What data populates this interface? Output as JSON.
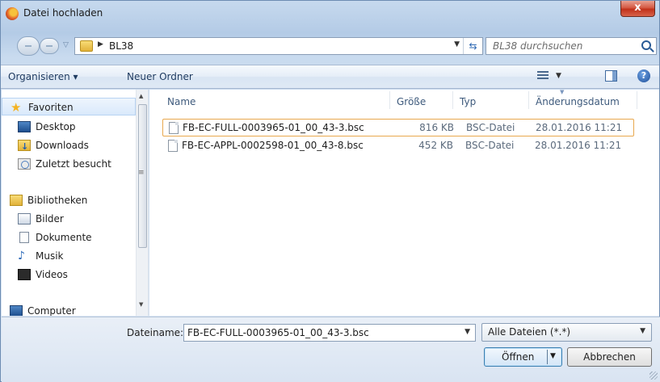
{
  "window": {
    "title": "Datei hochladen",
    "close_label": "x"
  },
  "nav": {
    "breadcrumb": "BL38",
    "search_placeholder": "BL38 durchsuchen"
  },
  "toolbar": {
    "organize": "Organisieren ▾",
    "new_folder": "Neuer Ordner"
  },
  "sidebar": {
    "items": [
      {
        "label": "Favoriten",
        "icon": "star-icon"
      },
      {
        "label": "Desktop",
        "icon": "desktop-icon"
      },
      {
        "label": "Downloads",
        "icon": "downloads-icon"
      },
      {
        "label": "Zuletzt besucht",
        "icon": "recent-places-icon"
      },
      {
        "label": "Bibliotheken",
        "icon": "libraries-icon"
      },
      {
        "label": "Bilder",
        "icon": "pictures-icon"
      },
      {
        "label": "Dokumente",
        "icon": "documents-icon"
      },
      {
        "label": "Musik",
        "icon": "music-icon"
      },
      {
        "label": "Videos",
        "icon": "videos-icon"
      },
      {
        "label": "Computer",
        "icon": "computer-icon"
      }
    ]
  },
  "files": {
    "columns": {
      "name": "Name",
      "size": "Größe",
      "type": "Typ",
      "date": "Änderungsdatum"
    },
    "rows": [
      {
        "name": "FB-EC-FULL-0003965-01_00_43-3.bsc",
        "size": "816 KB",
        "type": "BSC-Datei",
        "date": "28.01.2016 11:21"
      },
      {
        "name": "FB-EC-APPL-0002598-01_00_43-8.bsc",
        "size": "452 KB",
        "type": "BSC-Datei",
        "date": "28.01.2016 11:21"
      }
    ]
  },
  "footer": {
    "filename_label": "Dateiname:",
    "filename_value": "FB-EC-FULL-0003965-01_00_43-3.bsc",
    "filter_value": "Alle Dateien (*.*)",
    "open_label": "Öffnen",
    "cancel_label": "Abbrechen"
  },
  "colors": {
    "accent": "#3c7fb1",
    "selection_border": "#e8a84e",
    "close_red": "#c0311a"
  }
}
